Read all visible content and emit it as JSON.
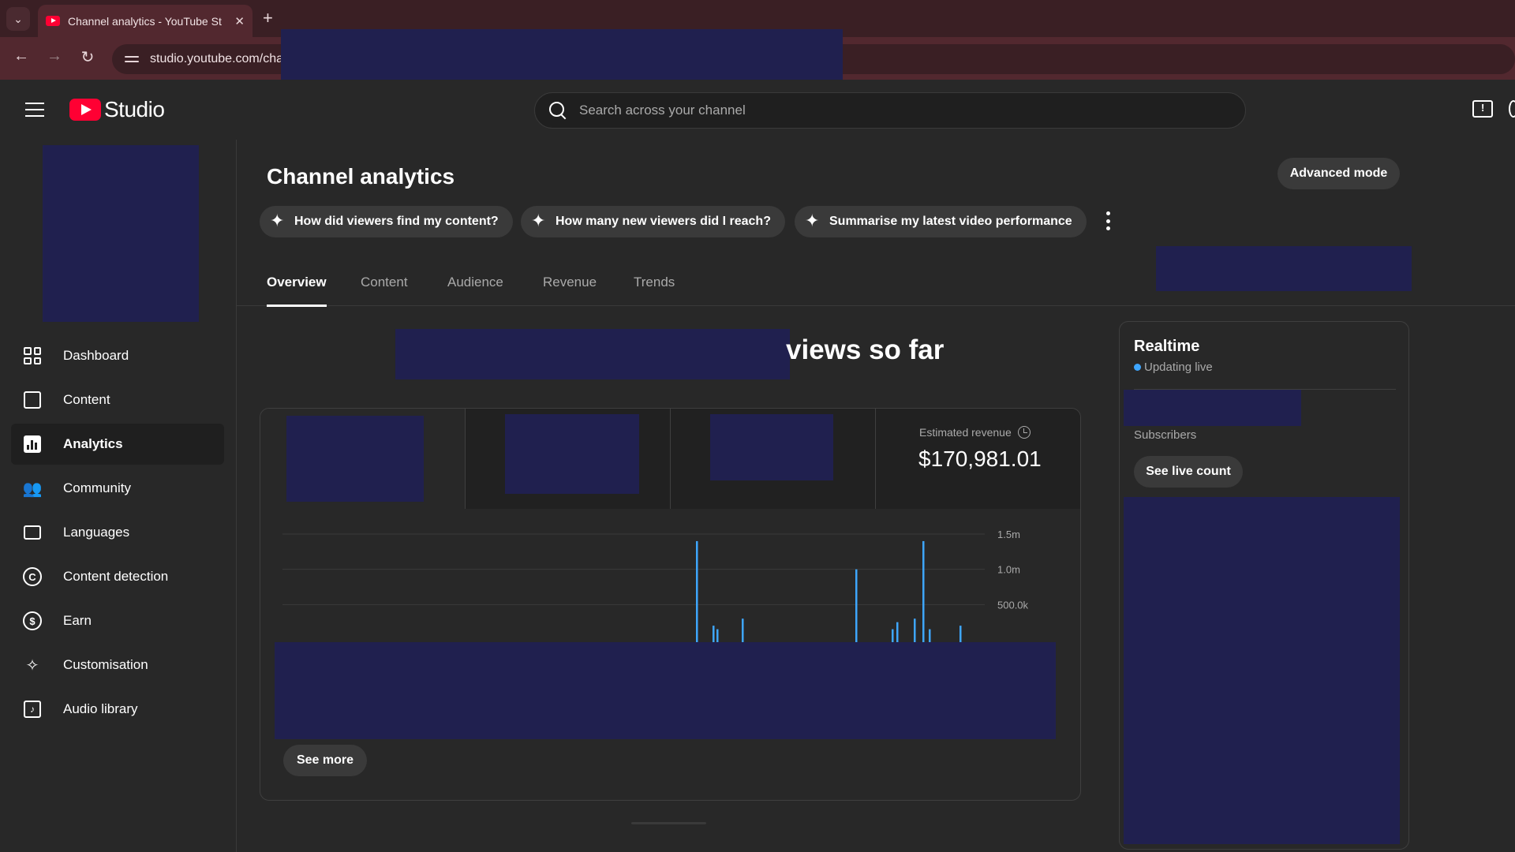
{
  "browser": {
    "tab_title": "Channel analytics - YouTube St",
    "new_tab_symbol": "+",
    "close_symbol": "✕",
    "tab_menu_symbol": "⌄",
    "url": "studio.youtube.com/cha",
    "back_symbol": "←",
    "forward_symbol": "→",
    "reload_symbol": "↻"
  },
  "header": {
    "logo_text": "Studio",
    "search_placeholder": "Search across your channel"
  },
  "sidebar": {
    "items": [
      {
        "label": "Dashboard",
        "icon": "dashboard-icon"
      },
      {
        "label": "Content",
        "icon": "content-icon"
      },
      {
        "label": "Analytics",
        "icon": "analytics-icon",
        "active": true
      },
      {
        "label": "Community",
        "icon": "community-icon"
      },
      {
        "label": "Languages",
        "icon": "languages-icon"
      },
      {
        "label": "Content detection",
        "icon": "copyright-icon"
      },
      {
        "label": "Earn",
        "icon": "dollar-icon"
      },
      {
        "label": "Customisation",
        "icon": "magic-wand-icon"
      },
      {
        "label": "Audio library",
        "icon": "audio-library-icon"
      }
    ]
  },
  "main": {
    "title": "Channel analytics",
    "advanced_mode_label": "Advanced mode",
    "chips": [
      "How did viewers find my content?",
      "How many new viewers did I reach?",
      "Summarise my latest video performance"
    ],
    "tabs": [
      "Overview",
      "Content",
      "Audience",
      "Revenue",
      "Trends"
    ],
    "active_tab": "Overview",
    "headline_suffix": "views so far",
    "metrics": {
      "revenue_label": "Estimated revenue",
      "revenue_value": "$170,981.01"
    },
    "see_more_label": "See more"
  },
  "chart_data": {
    "type": "bar",
    "y_ticks": [
      "1.5m",
      "1.0m",
      "500.0k"
    ],
    "ylim": [
      0,
      1500000
    ],
    "series": [
      {
        "values": [
          1400000,
          200000,
          150000,
          300000,
          1000000,
          150000,
          250000,
          300000,
          1400000,
          150000,
          200000
        ]
      }
    ],
    "grid": true,
    "color": "#3ea6ff"
  },
  "realtime": {
    "title": "Realtime",
    "status": "Updating live",
    "subscribers_label": "Subscribers",
    "see_live_label": "See live count"
  },
  "colors": {
    "accent": "#3ea6ff",
    "brand": "#ff0033",
    "background": "#282828"
  }
}
